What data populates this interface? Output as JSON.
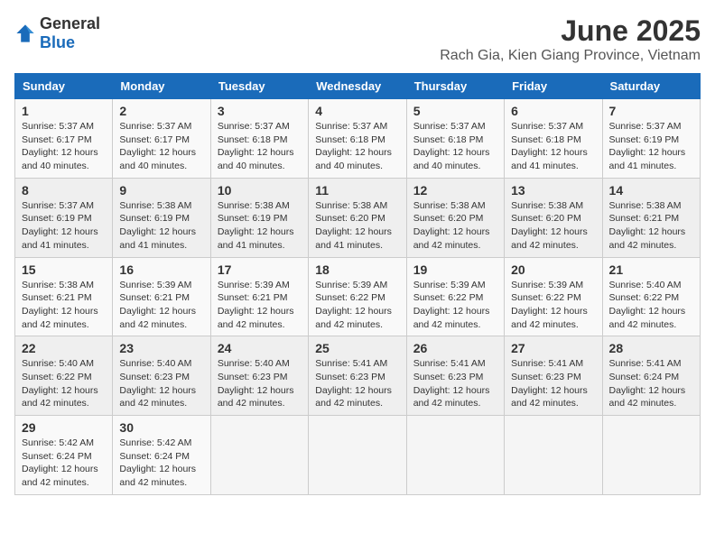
{
  "logo": {
    "general": "General",
    "blue": "Blue"
  },
  "header": {
    "title": "June 2025",
    "subtitle": "Rach Gia, Kien Giang Province, Vietnam"
  },
  "weekdays": [
    "Sunday",
    "Monday",
    "Tuesday",
    "Wednesday",
    "Thursday",
    "Friday",
    "Saturday"
  ],
  "weeks": [
    [
      {
        "day": "1",
        "sunrise": "5:37 AM",
        "sunset": "6:17 PM",
        "daylight": "12 hours and 40 minutes."
      },
      {
        "day": "2",
        "sunrise": "5:37 AM",
        "sunset": "6:17 PM",
        "daylight": "12 hours and 40 minutes."
      },
      {
        "day": "3",
        "sunrise": "5:37 AM",
        "sunset": "6:18 PM",
        "daylight": "12 hours and 40 minutes."
      },
      {
        "day": "4",
        "sunrise": "5:37 AM",
        "sunset": "6:18 PM",
        "daylight": "12 hours and 40 minutes."
      },
      {
        "day": "5",
        "sunrise": "5:37 AM",
        "sunset": "6:18 PM",
        "daylight": "12 hours and 40 minutes."
      },
      {
        "day": "6",
        "sunrise": "5:37 AM",
        "sunset": "6:18 PM",
        "daylight": "12 hours and 41 minutes."
      },
      {
        "day": "7",
        "sunrise": "5:37 AM",
        "sunset": "6:19 PM",
        "daylight": "12 hours and 41 minutes."
      }
    ],
    [
      {
        "day": "8",
        "sunrise": "5:37 AM",
        "sunset": "6:19 PM",
        "daylight": "12 hours and 41 minutes."
      },
      {
        "day": "9",
        "sunrise": "5:38 AM",
        "sunset": "6:19 PM",
        "daylight": "12 hours and 41 minutes."
      },
      {
        "day": "10",
        "sunrise": "5:38 AM",
        "sunset": "6:19 PM",
        "daylight": "12 hours and 41 minutes."
      },
      {
        "day": "11",
        "sunrise": "5:38 AM",
        "sunset": "6:20 PM",
        "daylight": "12 hours and 41 minutes."
      },
      {
        "day": "12",
        "sunrise": "5:38 AM",
        "sunset": "6:20 PM",
        "daylight": "12 hours and 42 minutes."
      },
      {
        "day": "13",
        "sunrise": "5:38 AM",
        "sunset": "6:20 PM",
        "daylight": "12 hours and 42 minutes."
      },
      {
        "day": "14",
        "sunrise": "5:38 AM",
        "sunset": "6:21 PM",
        "daylight": "12 hours and 42 minutes."
      }
    ],
    [
      {
        "day": "15",
        "sunrise": "5:38 AM",
        "sunset": "6:21 PM",
        "daylight": "12 hours and 42 minutes."
      },
      {
        "day": "16",
        "sunrise": "5:39 AM",
        "sunset": "6:21 PM",
        "daylight": "12 hours and 42 minutes."
      },
      {
        "day": "17",
        "sunrise": "5:39 AM",
        "sunset": "6:21 PM",
        "daylight": "12 hours and 42 minutes."
      },
      {
        "day": "18",
        "sunrise": "5:39 AM",
        "sunset": "6:22 PM",
        "daylight": "12 hours and 42 minutes."
      },
      {
        "day": "19",
        "sunrise": "5:39 AM",
        "sunset": "6:22 PM",
        "daylight": "12 hours and 42 minutes."
      },
      {
        "day": "20",
        "sunrise": "5:39 AM",
        "sunset": "6:22 PM",
        "daylight": "12 hours and 42 minutes."
      },
      {
        "day": "21",
        "sunrise": "5:40 AM",
        "sunset": "6:22 PM",
        "daylight": "12 hours and 42 minutes."
      }
    ],
    [
      {
        "day": "22",
        "sunrise": "5:40 AM",
        "sunset": "6:22 PM",
        "daylight": "12 hours and 42 minutes."
      },
      {
        "day": "23",
        "sunrise": "5:40 AM",
        "sunset": "6:23 PM",
        "daylight": "12 hours and 42 minutes."
      },
      {
        "day": "24",
        "sunrise": "5:40 AM",
        "sunset": "6:23 PM",
        "daylight": "12 hours and 42 minutes."
      },
      {
        "day": "25",
        "sunrise": "5:41 AM",
        "sunset": "6:23 PM",
        "daylight": "12 hours and 42 minutes."
      },
      {
        "day": "26",
        "sunrise": "5:41 AM",
        "sunset": "6:23 PM",
        "daylight": "12 hours and 42 minutes."
      },
      {
        "day": "27",
        "sunrise": "5:41 AM",
        "sunset": "6:23 PM",
        "daylight": "12 hours and 42 minutes."
      },
      {
        "day": "28",
        "sunrise": "5:41 AM",
        "sunset": "6:24 PM",
        "daylight": "12 hours and 42 minutes."
      }
    ],
    [
      {
        "day": "29",
        "sunrise": "5:42 AM",
        "sunset": "6:24 PM",
        "daylight": "12 hours and 42 minutes."
      },
      {
        "day": "30",
        "sunrise": "5:42 AM",
        "sunset": "6:24 PM",
        "daylight": "12 hours and 42 minutes."
      },
      null,
      null,
      null,
      null,
      null
    ]
  ]
}
